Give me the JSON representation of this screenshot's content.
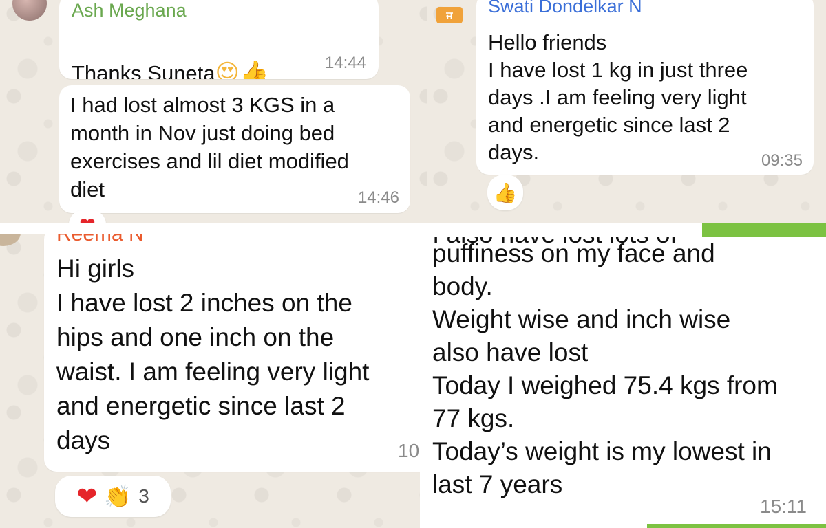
{
  "top_left": {
    "msg1": {
      "sender": "Ash Meghana",
      "text": "Thanks Suneta",
      "emojis": [
        "😍",
        "👍"
      ],
      "time": "14:44"
    },
    "msg2": {
      "text": "I had lost almost 3 KGS in a\nmonth in Nov just doing bed\nexercises and lil diet modified\ndiet",
      "time": "14:46",
      "reaction": "❤"
    }
  },
  "top_right": {
    "sender": "Swati Dondelkar N",
    "text": "Hello friends\nI have lost 1 kg in just three\ndays .I am feeling very light\nand energetic since last 2\ndays.",
    "time": "09:35",
    "reaction": "👍"
  },
  "bottom_left": {
    "sender": "Reema N",
    "text": "Hi girls\nI have lost 2 inches on the\nhips and one inch on the\nwaist. I am feeling very light\nand energetic since last 2\ndays",
    "time_partial": "10",
    "reactions": [
      "❤",
      "👏"
    ],
    "reaction_count": "3"
  },
  "bottom_right": {
    "text_top_cut": "I also have lost lots of",
    "text": "puffiness on my face and\nbody.\nWeight wise and inch wise\nalso have lost\nToday I weighed 75.4 kgs from\n77 kgs.\nToday’s weight is my lowest in\nlast 7 years",
    "time": "15:11"
  },
  "colors": {
    "chat_bg": "#efeae2",
    "sender_green": "#6aa84f",
    "sender_blue": "#3b6fd8",
    "sender_orange": "#ea5b2e",
    "accent_green": "#7cc242"
  }
}
